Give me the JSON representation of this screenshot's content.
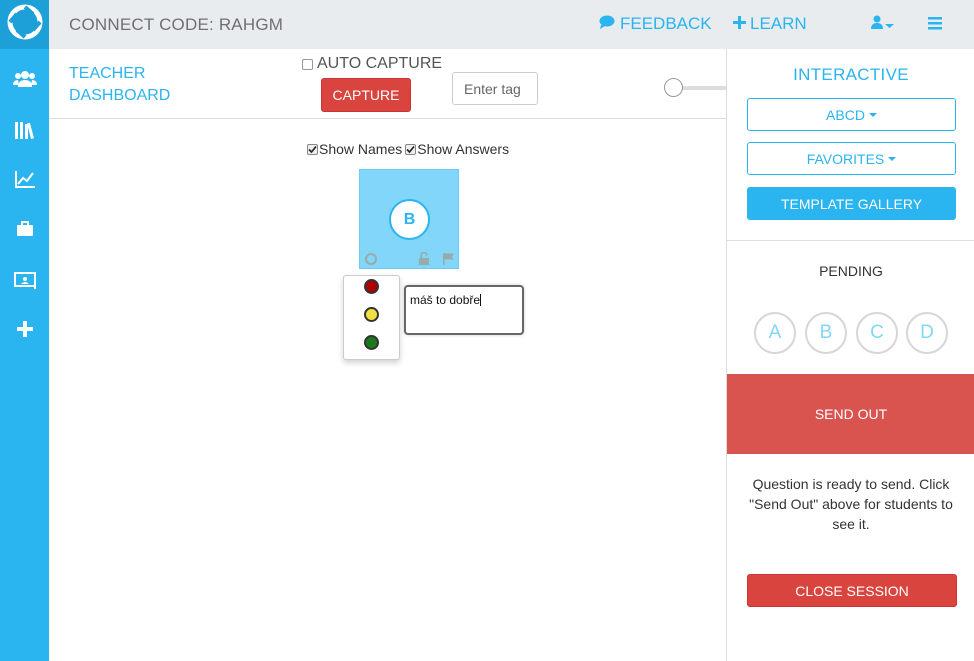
{
  "topbar": {
    "connect_code": "CONNECT CODE: RAHGM",
    "feedback_label": "FEEDBACK",
    "learn_label": "LEARN"
  },
  "sidebar": {
    "items": [
      {
        "icon": "users-icon"
      },
      {
        "icon": "library-icon"
      },
      {
        "icon": "chart-line-icon"
      },
      {
        "icon": "briefcase-icon"
      },
      {
        "icon": "presentation-icon"
      },
      {
        "icon": "plus-icon"
      }
    ]
  },
  "toolbar": {
    "title": "TEACHER DASHBOARD",
    "auto_capture_label": "AUTO CAPTURE",
    "capture_label": "CAPTURE",
    "tag_placeholder": "Enter tag"
  },
  "main": {
    "show_names_label": "Show Names",
    "show_answers_label": "Show Answers",
    "student_answer": "B",
    "feedback_text": "máš to dobře",
    "color_options": [
      {
        "name": "red",
        "color": "#b00000"
      },
      {
        "name": "yellow",
        "color": "#f0e040"
      },
      {
        "name": "green",
        "color": "#1a7a1a"
      }
    ]
  },
  "right_panel": {
    "title": "INTERACTIVE",
    "abcd_label": "ABCD",
    "favorites_label": "FAVORITES",
    "template_gallery_label": "TEMPLATE GALLERY",
    "status_label": "PENDING",
    "choices": [
      "A",
      "B",
      "C",
      "D"
    ],
    "send_out_label": "SEND OUT",
    "ready_message": "Question is ready to send. Click \"Send Out\" above for students to see it.",
    "close_session_label": "CLOSE SESSION"
  },
  "colors": {
    "accent": "#2ab4f0",
    "danger": "#d9443f",
    "card": "#82d6f9"
  }
}
